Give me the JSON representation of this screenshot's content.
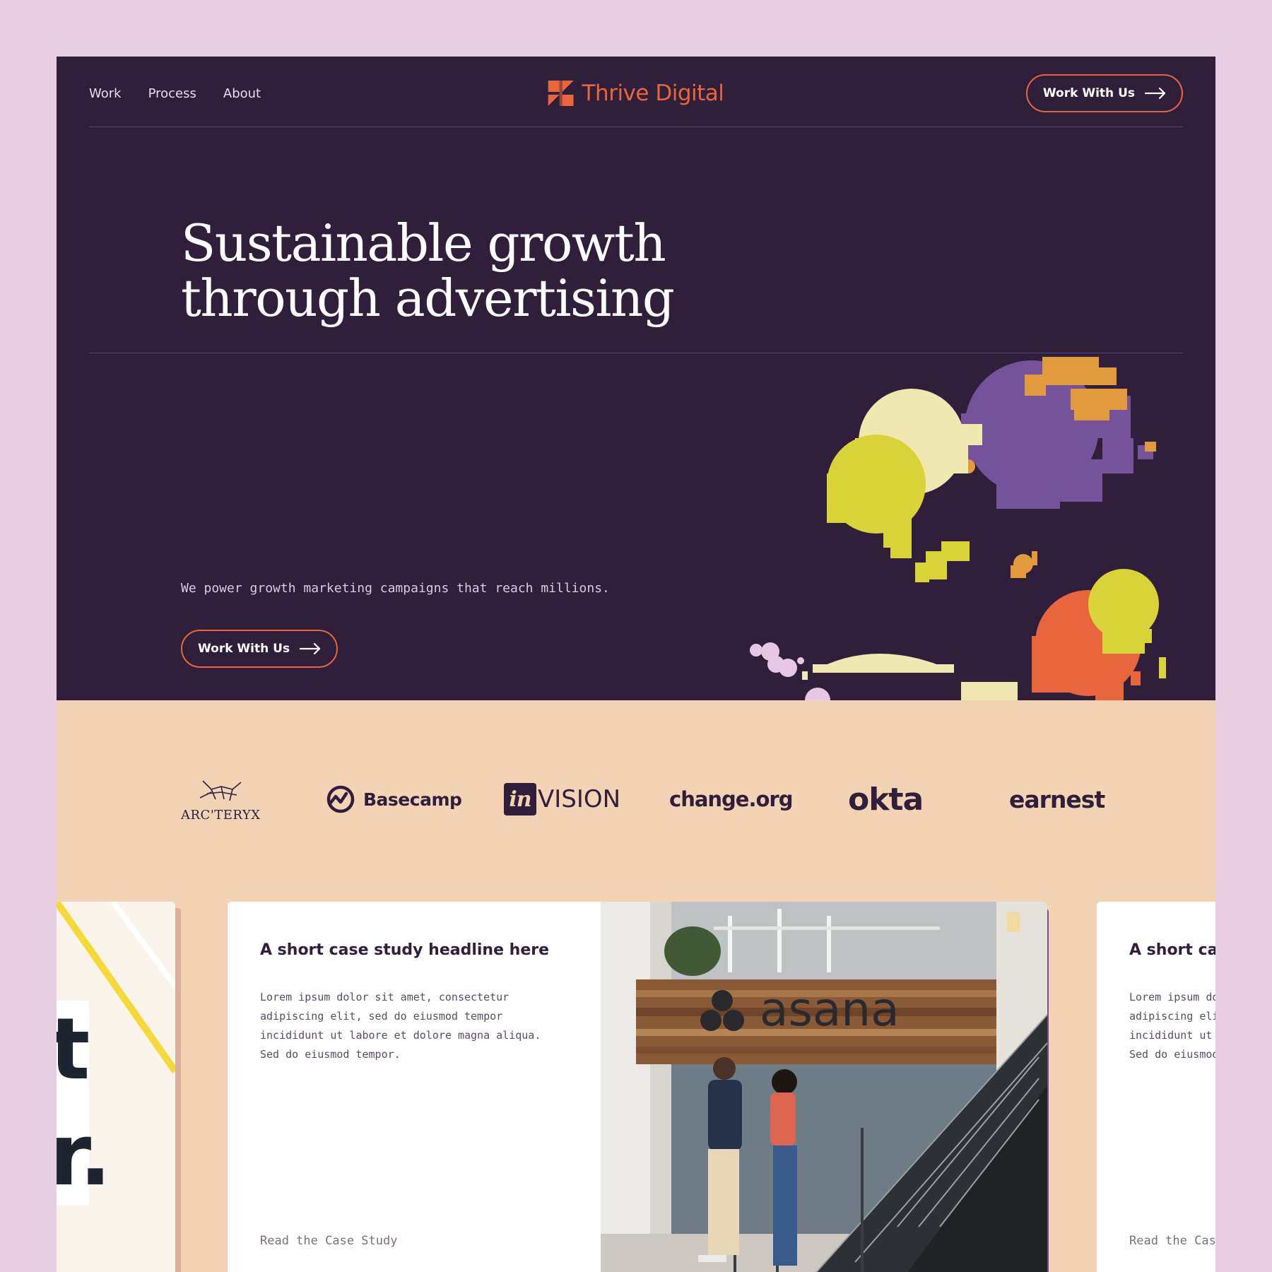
{
  "nav": {
    "links": [
      "Work",
      "Process",
      "About"
    ],
    "brand": "Thrive Digital",
    "cta": "Work With Us"
  },
  "hero": {
    "title_line1": "Sustainable growth",
    "title_line2": "through advertising",
    "subtitle": "We power growth marketing campaigns that reach millions.",
    "cta": "Work With Us"
  },
  "logos": [
    {
      "name": "ARC'TERYX",
      "icon": "arcteryx-logo"
    },
    {
      "name": "Basecamp",
      "icon": "basecamp-logo"
    },
    {
      "name": "invision",
      "icon": "invision-logo"
    },
    {
      "name": "change.org",
      "icon": "changeorg-logo"
    },
    {
      "name": "okta",
      "icon": "okta-logo"
    },
    {
      "name": "earnest",
      "icon": "earnest-logo"
    }
  ],
  "cards": {
    "left": {
      "letters": [
        "t",
        "r."
      ]
    },
    "main": {
      "headline": "A short case study headline here",
      "body": "Lorem ipsum dolor sit amet, consectetur adipiscing elit, sed do eiusmod tempor incididunt ut labore et dolore magna aliqua.  Sed do eiusmod tempor.",
      "link": "Read the Case Study",
      "photo_sign": "asana"
    },
    "right": {
      "headline": "A short case study headline here",
      "body": "Lorem ipsum dolor sit amet, consectetur adipiscing elit, sed do eiusmod tempor incididunt ut labore et dolore magna aliqua.  Sed do eiusmod tempor.",
      "link": "Read the Case Study"
    }
  },
  "colors": {
    "hero_bg": "#2f1f3b",
    "accent": "#e9663c",
    "logo_bg": "#f2d4b4",
    "page_bg": "#e9cde3",
    "art_yellow": "#d9d33a",
    "art_cream": "#efe8b0",
    "art_purple": "#74539a",
    "art_orange": "#e9663c",
    "art_amber": "#e39a3c",
    "art_lilac": "#e6c8e6"
  }
}
